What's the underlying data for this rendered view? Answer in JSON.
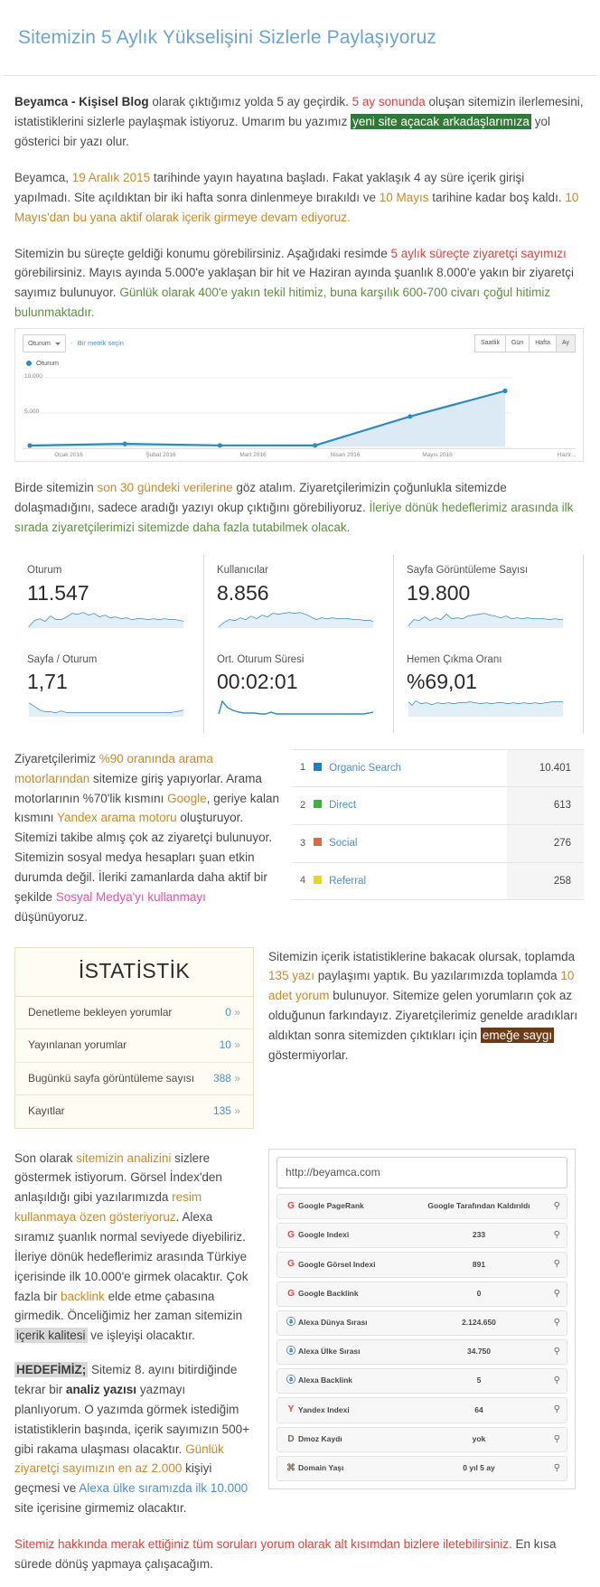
{
  "post": {
    "title": "Sitemizin 5 Aylık Yükselişini Sizlerle Paylaşıyoruz"
  },
  "paragraph1": {
    "bold_lead": "Beyamca - Kişisel Blog",
    "t1": " olarak çıktığımız yolda 5 ay geçirdik. ",
    "red1": "5 ay sonunda",
    "t2": " oluşan sitemizin ilerlemesini, istatistiklerini sizlerle paylaşmak istiyoruz. Umarım bu yazımız ",
    "hl1": "yeni site açacak arkadaşlarımıza",
    "t3": " yol gösterici bir yazı olur."
  },
  "paragraph2": {
    "t1": "Beyamca, ",
    "orange1": "19 Aralık 2015",
    "t2": " tarihinde yayın hayatına başladı. Fakat yaklaşık 4 ay süre içerik girişi yapılmadı. Site açıldıktan bir iki hafta sonra dinlenmeye bırakıldı ve ",
    "orange2": "10 Mayıs",
    "t3": " tarihine kadar boş kaldı. ",
    "orange3": "10 Mayıs'dan bu yana aktif olarak içerik girmeye devam ediyoruz."
  },
  "paragraph3": {
    "t1": "Sitemizin bu süreçte geldiği konumu görebilirsiniz. Aşağıdaki resimde ",
    "red1": "5 aylık süreçte ziyaretçi sayımızı",
    "t2": " görebilirsiniz. Mayıs ayında 5.000'e yaklaşan bir hit ve Haziran ayında şuanlık 8.000'e yakın bir ziyaretçi sayımız bulunuyor. ",
    "green1": "Günlük olarak 400'e yakın tekil hitimiz, buna karşılık 600-700 civarı çoğul hitimiz bulunmaktadır."
  },
  "paragraph4": {
    "t1": "Birde sitemizin ",
    "orange1": "son 30 gündeki verilerine",
    "t2": " göz atalım. Ziyaretçilerimizin çoğunlukla sitemizde dolaşmadığını, sadece aradığı yazıyı okup çıktığını görebiliyoruz. ",
    "green1": "İleriye dönük hedeflerimiz arasında ilk sırada ziyaretçilerimizi sitemizde daha fazla tutabilmek olacak."
  },
  "ga_toolbar": {
    "metric_select": "Oturum",
    "separator": "-",
    "metric_placeholder": "Bir metrik seçin",
    "ranges": [
      "Saatlik",
      "Gün",
      "Hafta",
      "Ay"
    ],
    "active_range": "Ay",
    "legend": "Oturum"
  },
  "chart_data": {
    "type": "line",
    "title": "Oturum",
    "categories": [
      "Ocak 2016",
      "Şubat 2016",
      "Mart 2016",
      "Nisan 2016",
      "Mayıs 2016",
      "Hazir..."
    ],
    "values": [
      150,
      420,
      180,
      160,
      4800,
      8900
    ],
    "series": [
      {
        "name": "Oturum",
        "values": [
          150,
          420,
          180,
          160,
          4800,
          8900
        ]
      }
    ],
    "ytick_labels": [
      "10.000",
      "5.000"
    ],
    "yticks": [
      10000,
      5000
    ],
    "ylim": [
      0,
      11000
    ],
    "xlabel": "",
    "ylabel": "",
    "grid": true,
    "legend_position": "top-left",
    "line_color": "#2b8bc4",
    "fill_color": "#dceaf5"
  },
  "cards": [
    {
      "label": "Oturum",
      "value": "11.547"
    },
    {
      "label": "Kullanıcılar",
      "value": "8.856"
    },
    {
      "label": "Sayfa Görüntüleme Sayısı",
      "value": "19.800"
    },
    {
      "label": "Sayfa / Oturum",
      "value": "1,71"
    },
    {
      "label": "Ort. Oturum Süresi",
      "value": "00:02:01"
    },
    {
      "label": "Hemen Çıkma Oranı",
      "value": "%69,01"
    }
  ],
  "paragraph5": {
    "t1": "Ziyaretçilerimiz ",
    "orange1": "%90 oranında arama motorlarından",
    "t2": " sitemize giriş yapıyorlar. Arama motorlarının %70'lik kısmını ",
    "orange2": "Google",
    "t3": ", geriye kalan kısmını ",
    "orange3": "Yandex arama motoru",
    "t4": " oluşturuyor. Sitemizi takibe almış çok az ziyaretçi bulunuyor. Sitemizin sosyal medya hesapları şuan etkin durumda değil. İleriki zamanlarda daha aktif bir şekilde ",
    "pink1": "Sosyal Medya'yı kullanmayı",
    "t5": " düşünüyoruz."
  },
  "traffic_sources": {
    "rows": [
      {
        "rank": "1",
        "name": "Organic Search",
        "value": "10.401",
        "color": "#1c7ec4"
      },
      {
        "rank": "2",
        "name": "Direct",
        "value": "613",
        "color": "#36b83a"
      },
      {
        "rank": "3",
        "name": "Social",
        "value": "276",
        "color": "#e8623c"
      },
      {
        "rank": "4",
        "name": "Referral",
        "value": "258",
        "color": "#f2d60c"
      }
    ]
  },
  "stat_widget": {
    "title": "İSTATİSTİK",
    "rows": [
      {
        "label": "Denetleme bekleyen yorumlar",
        "value": "0",
        "arrow": "»"
      },
      {
        "label": "Yayınlanan yorumlar",
        "value": "10",
        "arrow": "»"
      },
      {
        "label": "Bugünkü sayfa görüntüleme sayısı",
        "value": "388",
        "arrow": "»"
      },
      {
        "label": "Kayıtlar",
        "value": "135",
        "arrow": "»"
      }
    ]
  },
  "paragraph6": {
    "t1": "Sitemizin içerik istatistiklerine bakacak olursak, toplamda ",
    "orange1": "135 yazı",
    "t2": " paylaşımı yaptık. Bu yazılarımızda toplamda ",
    "orange2": "10 adet yorum",
    "t3": " bulunuyor. Sitemize gelen yorumların çok az olduğunun farkındayız. Ziyaretçilerimiz genelde aradıkları aldıktan sonra sitemizden çıktıkları için ",
    "hl1": "emeğe saygı",
    "t4": " göstermiyorlar."
  },
  "paragraph7": {
    "t1": "Son olarak ",
    "orange1": "sitemizin analizini",
    "t2": " sizlere göstermek istiyorum. Görsel İndex'den anlaşıldığı gibi yazılarımızda ",
    "orange2": "resim kullanmaya özen gösteriyoruz",
    "t3": ". Alexa sıramız şuanlık normal seviyede diyebiliriz. İleriye dönük hedeflerimiz arasında Türkiye içerisinde ilk 10.000'e girmek olacaktır. Çok fazla bir ",
    "orange3": "backlink",
    "t4": " elde etme çabasına girmedik. Önceliğimiz her zaman sitemizin ",
    "hl1": "içerik kalitesi",
    "t5": " ve işleyişi olacaktır."
  },
  "paragraph8": {
    "hl1": "HEDEFİMİZ;",
    "t1": " Sitemiz 8. ayını bitirdiğinde tekrar bir ",
    "b1": "analiz yazısı",
    "t2": " yazmayı planlıyorum. O yazımda görmek istediğim istatistiklerin başında, içerik sayımızın 500+ gibi rakama ulaşması olacaktır. ",
    "orange1": "Günlük ziyaretçi sayımızın en az 2.000",
    "t3": " kişiyi geçmesi ve ",
    "blue1": "Alexa ülke sıramızda ilk 10.000",
    "t4": " site içerisine girmemiz olacaktır."
  },
  "paragraph9": {
    "red1": "Sitemiz hakkında merak ettiğiniz tüm soruları yorum olarak alt kısımdan bizlere iletebilirsiniz.",
    "t1": " En kısa sürede dönüş yapmaya çalışacağım."
  },
  "seo_box": {
    "url": "http://beyamca.com",
    "rows": [
      {
        "icon": "google-icon",
        "icon_letter": "G",
        "icon_kind": "g",
        "label": "Google PageRank",
        "value": "Google Tarafından Kaldırıldı"
      },
      {
        "icon": "google-icon",
        "icon_letter": "G",
        "icon_kind": "g",
        "label": "Google Indexi",
        "value": "233"
      },
      {
        "icon": "google-icon",
        "icon_letter": "G",
        "icon_kind": "g",
        "label": "Google Görsel Indexi",
        "value": "891"
      },
      {
        "icon": "google-icon",
        "icon_letter": "G",
        "icon_kind": "g",
        "label": "Google Backlink",
        "value": "0"
      },
      {
        "icon": "alexa-icon",
        "icon_letter": "ⓐ",
        "icon_kind": "a",
        "label": "Alexa Dünya Sırası",
        "value": "2.124.650"
      },
      {
        "icon": "alexa-icon",
        "icon_letter": "ⓐ",
        "icon_kind": "a",
        "label": "Alexa Ülke Sırası",
        "value": "34.750"
      },
      {
        "icon": "alexa-icon",
        "icon_letter": "ⓐ",
        "icon_kind": "a",
        "label": "Alexa Backlink",
        "value": "5"
      },
      {
        "icon": "yandex-icon",
        "icon_letter": "Y",
        "icon_kind": "y",
        "label": "Yandex Indexi",
        "value": "64"
      },
      {
        "icon": "dmoz-icon",
        "icon_letter": "D",
        "icon_kind": "d",
        "label": "Dmoz Kaydı",
        "value": "yok"
      },
      {
        "icon": "domain-age-icon",
        "icon_letter": "⌘",
        "icon_kind": "d",
        "label": "Domain Yaşı",
        "value": "0 yıl 5 ay"
      }
    ],
    "search_icon": "search-icon"
  }
}
